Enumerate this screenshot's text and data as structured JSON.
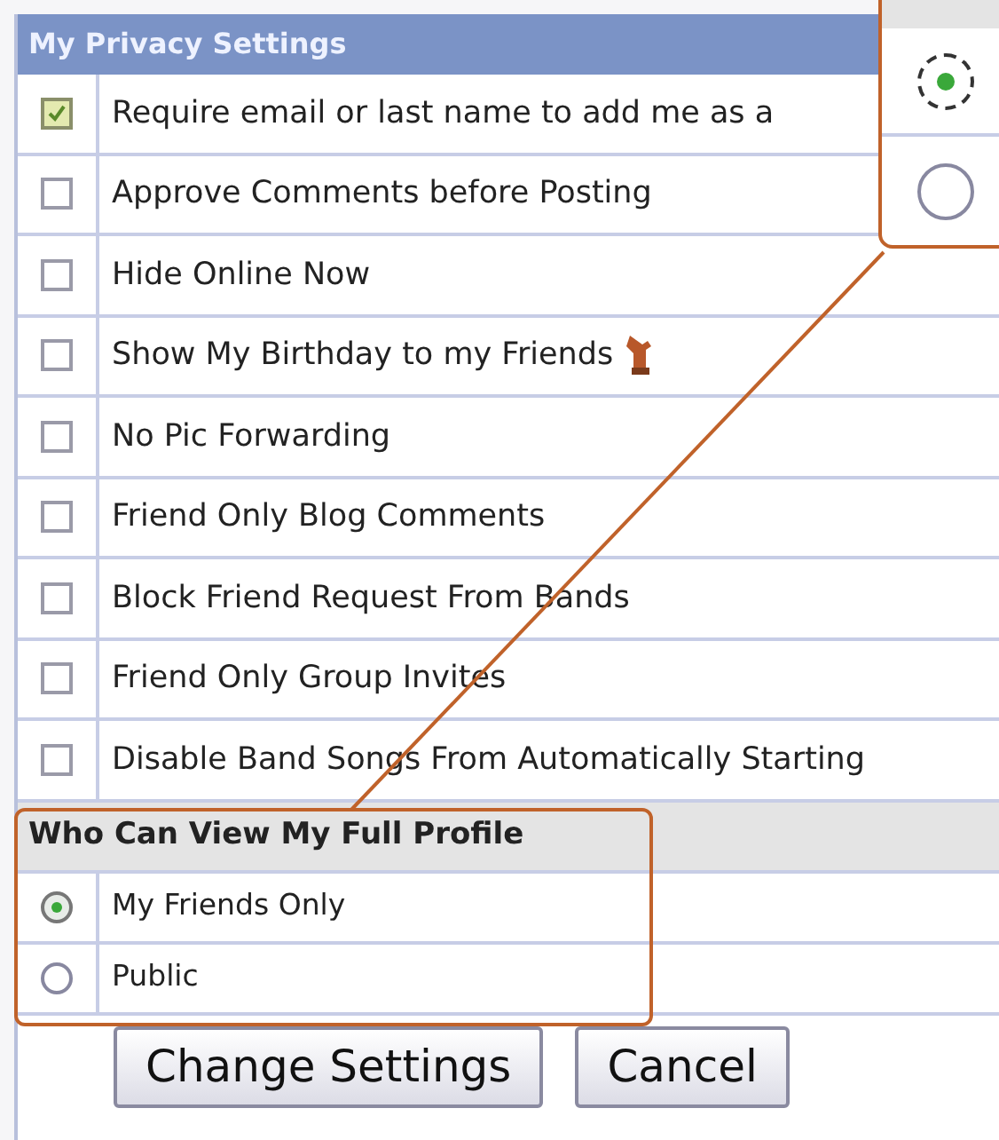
{
  "panel": {
    "title": "My Privacy Settings",
    "options": [
      {
        "label": "Require email or last name to add me as a",
        "checked": true
      },
      {
        "label": "Approve Comments before Posting",
        "checked": false
      },
      {
        "label": "Hide Online Now",
        "checked": false
      },
      {
        "label": "Show My Birthday to my Friends",
        "checked": false,
        "kind": "birthday"
      },
      {
        "label": "No Pic Forwarding",
        "checked": false
      },
      {
        "label": "Friend Only Blog Comments",
        "checked": false
      },
      {
        "label": "Block Friend Request From Bands",
        "checked": false
      },
      {
        "label": "Friend Only Group Invites",
        "checked": false
      },
      {
        "label": "Disable Band Songs From Automatically Starting",
        "checked": false
      }
    ],
    "profile_section": {
      "title": "Who Can View My Full Profile",
      "choices": [
        {
          "label": "My Friends Only",
          "selected": true
        },
        {
          "label": "Public",
          "selected": false
        }
      ]
    },
    "buttons": [
      "Change Settings",
      "Cancel"
    ]
  },
  "callout": {
    "choices": [
      {
        "selected": true
      },
      {
        "selected": false
      }
    ]
  }
}
